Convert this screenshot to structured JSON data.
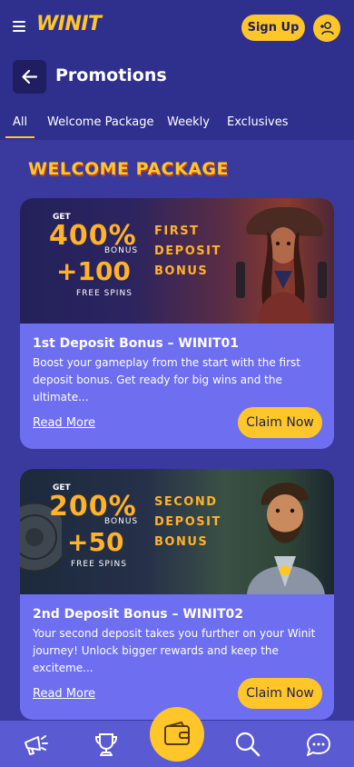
{
  "header": {
    "logo_text": "WINIT",
    "signup_label": "Sign Up"
  },
  "page": {
    "title": "Promotions"
  },
  "tabs": [
    {
      "label": "All",
      "active": true
    },
    {
      "label": "Welcome Package"
    },
    {
      "label": "Weekly"
    },
    {
      "label": "Exclusives"
    }
  ],
  "section": {
    "title": "WELCOME PACKAGE"
  },
  "promotions": [
    {
      "banner": {
        "get": "GET",
        "percent": "400%",
        "bonus": "BONUS",
        "plus": "+100",
        "free_spins": "FREE SPINS",
        "label": "FIRST DEPOSIT BONUS"
      },
      "title": "1st Deposit Bonus – WINIT01",
      "description": "Boost your gameplay from the start with the first deposit bonus. Get ready for big wins and the ultimate...",
      "read_more": "Read More",
      "claim": "Claim Now"
    },
    {
      "banner": {
        "get": "GET",
        "percent": "200%",
        "bonus": "BONUS",
        "plus": "+50",
        "free_spins": "FREE SPINS",
        "label": "SECOND DEPOSIT BONUS"
      },
      "title": "2nd Deposit Bonus – WINIT02",
      "description": "Your second deposit takes you further on your Winit journey! Unlock bigger rewards and keep the exciteme...",
      "read_more": "Read More",
      "claim": "Claim Now"
    }
  ],
  "bottom_nav": {
    "icons": [
      "megaphone-icon",
      "trophy-icon",
      "wallet-icon",
      "search-icon",
      "chat-icon"
    ]
  },
  "colors": {
    "accent": "#ffc629",
    "background": "#3a3a9e",
    "card": "#6e6ef0"
  }
}
